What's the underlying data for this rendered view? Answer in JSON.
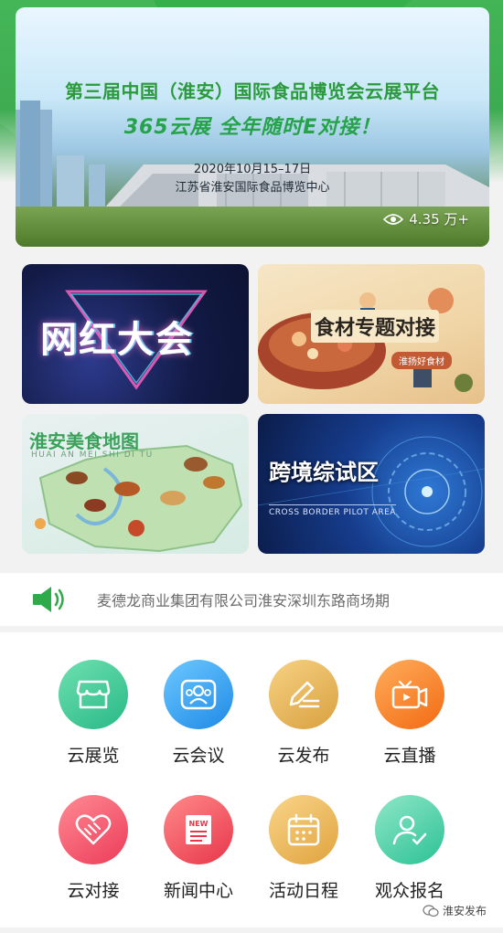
{
  "banner": {
    "title": "第三届中国（淮安）国际食品博览会云展平台",
    "slogan": "365云展  全年随时E对接！",
    "date": "2020年10月15–17日",
    "venue": "江苏省淮安国际食品博览中心",
    "views": "4.35 万+",
    "view_icon": "eye-icon"
  },
  "tiles": [
    {
      "label": "网红大会"
    },
    {
      "label": "食材专题对接",
      "sub": "淮扬好食材"
    },
    {
      "label": "淮安美食地图",
      "sub": "HUAI AN MEI SHI DI TU"
    },
    {
      "label": "跨境综试区",
      "sub": "CROSS BORDER PILOT AREA"
    }
  ],
  "notice": {
    "icon": "speaker-icon",
    "text": "麦德龙商业集团有限公司淮安深圳东路商场期"
  },
  "services": [
    {
      "label": "云展览",
      "icon": "store-icon",
      "color": "#28b987"
    },
    {
      "label": "云会议",
      "icon": "meeting-icon",
      "color": "#1f8ae6"
    },
    {
      "label": "云发布",
      "icon": "pen-icon",
      "color": "#d9a03f"
    },
    {
      "label": "云直播",
      "icon": "video-icon",
      "color": "#f36a12"
    },
    {
      "label": "云对接",
      "icon": "handshake-icon",
      "color": "#ec3b59"
    },
    {
      "label": "新闻中心",
      "icon": "news-icon",
      "color": "#e8364a"
    },
    {
      "label": "活动日程",
      "icon": "calendar-icon",
      "color": "#e0a33d"
    },
    {
      "label": "观众报名",
      "icon": "user-check-icon",
      "color": "#2cc194"
    }
  ],
  "watermark": "淮安发布"
}
